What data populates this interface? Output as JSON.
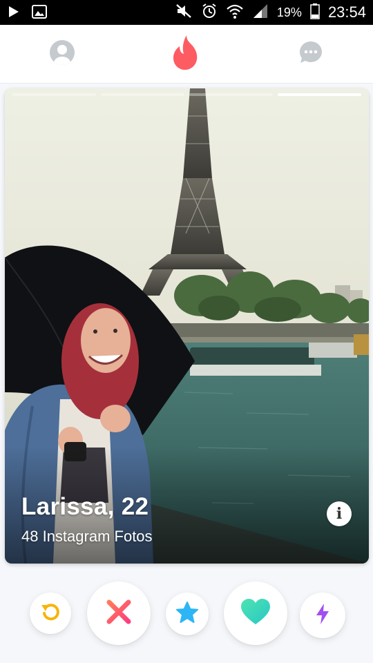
{
  "status_bar": {
    "battery_text": "19%",
    "time": "23:54"
  },
  "header": {
    "left_icon": "profile-icon",
    "center_icon": "flame-logo-icon",
    "right_icon": "chat-icon",
    "accent_color": "#fd5068"
  },
  "card": {
    "photo_count": 4,
    "active_photo_index": 3,
    "name_age": "Larissa, 22",
    "subtitle": "48 Instagram Fotos",
    "info_label": "i"
  },
  "actions": [
    {
      "name": "rewind-button",
      "icon": "rewind-icon",
      "color": "#f5b50a"
    },
    {
      "name": "nope-button",
      "icon": "x-icon",
      "color": "#fd4f6c"
    },
    {
      "name": "super-like-button",
      "icon": "star-icon",
      "color": "#2db5f5"
    },
    {
      "name": "like-button",
      "icon": "heart-icon",
      "color": "#3ed7b5"
    },
    {
      "name": "boost-button",
      "icon": "lightning-icon",
      "color": "#a24ff0"
    }
  ]
}
